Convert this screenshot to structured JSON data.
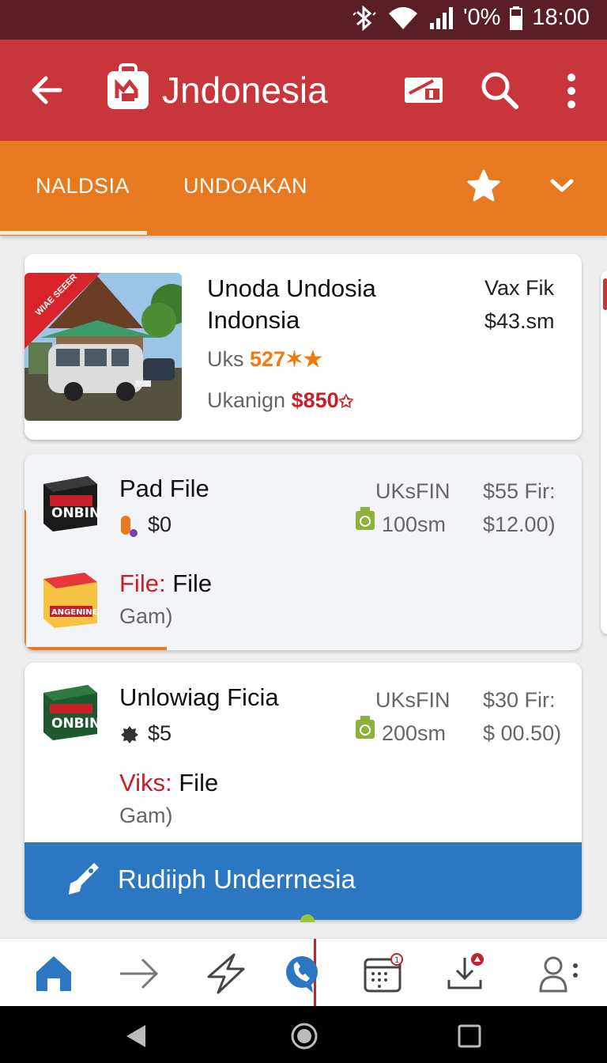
{
  "status_bar": {
    "battery_text": "'0%",
    "time": "18:00"
  },
  "app_bar": {
    "title": "Jndonesia"
  },
  "tabs": [
    {
      "label": "NALDSIA",
      "selected": true
    },
    {
      "label": "UNDOAKAN",
      "selected": false
    }
  ],
  "listing": {
    "ribbon": "WIAE SEEER",
    "title_line1": "Unoda Undosia",
    "title_line2": "Indonsia",
    "price_label": "Vax Fik",
    "price": "$43.sm",
    "rating_label": "Uks",
    "rating_value": "527",
    "discount_label": "Ukanign",
    "discount_value": "$850"
  },
  "items": [
    {
      "title": "Pad File",
      "price": "$0",
      "col1_header": "UKsFIN",
      "col1_value": "100sm",
      "col2_header": "$55 Fir:",
      "col2_value": "$12.00)",
      "box_label": "ONBINI",
      "sub_label_red": "File:",
      "sub_label": "File",
      "sub_note": "Gam)",
      "sub_box_label": "ANGENINE"
    },
    {
      "title": "Unlowiag Ficia",
      "price": "$5",
      "col1_header": "UKsFIN",
      "col1_value": "200sm",
      "col2_header": "$30 Fir:",
      "col2_value": "$ 00.50)",
      "box_label": "ONBINI",
      "sub_label_red": "Viks:",
      "sub_label": "File",
      "sub_note": "Gam)"
    }
  ],
  "cta": {
    "label": "Rudiiph Underrnesia"
  },
  "bottom_nav": [
    "home-icon",
    "arrow-right-icon",
    "lightning-icon",
    "phone-chat-icon",
    "calendar-icon",
    "download-icon",
    "profile-icon"
  ],
  "colors": {
    "status": "#5a1f24",
    "app_bar": "#c8363b",
    "tabs": "#e77a20",
    "cta": "#2b77c1",
    "accent_red": "#c8202a",
    "accent_orange": "#f07a10",
    "nav_active": "#2b77c1"
  }
}
